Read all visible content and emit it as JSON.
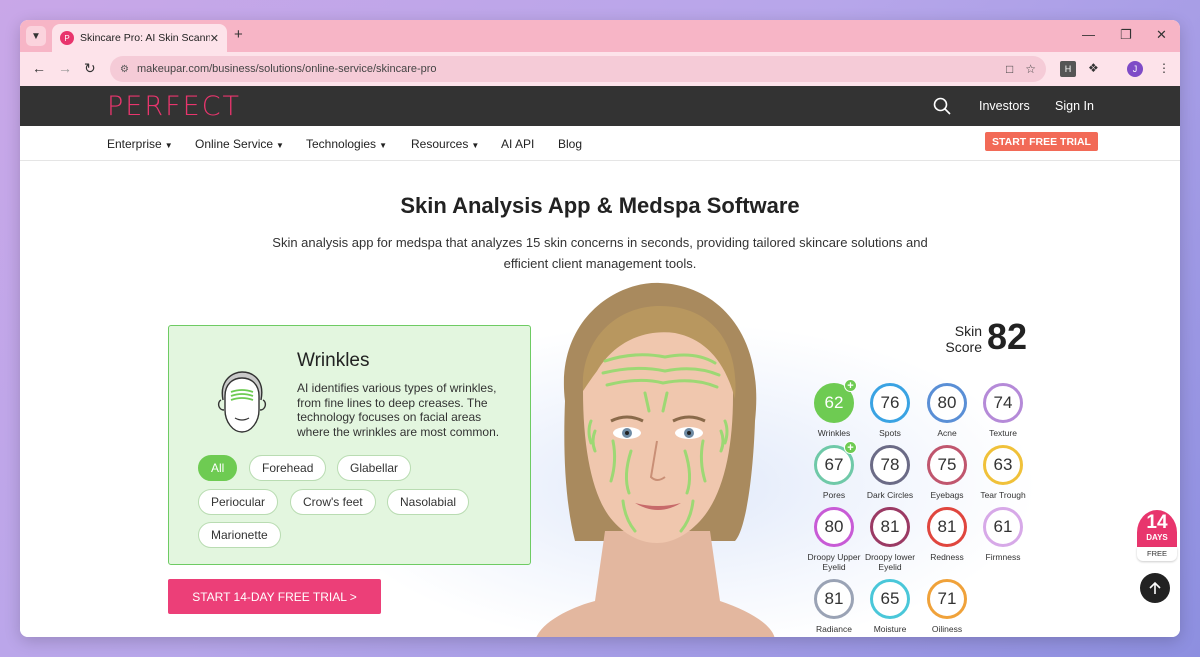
{
  "browser": {
    "tab_title": "Skincare Pro: AI Skin Scanner",
    "tab_favicon_letter": "P",
    "url": "makeupar.com/business/solutions/online-service/skincare-pro",
    "ext_letter": "H",
    "profile_letter": "J"
  },
  "site": {
    "logo": "PERFECT",
    "top_links": [
      "Investors",
      "Sign In"
    ],
    "nav": [
      "Enterprise",
      "Online Service",
      "Technologies",
      "Resources",
      "AI API",
      "Blog"
    ],
    "trial_button": "START FREE TRIAL"
  },
  "hero": {
    "title": "Skin Analysis App & Medspa Software",
    "subtitle": "Skin analysis app for medspa that analyzes 15 skin concerns in seconds, providing tailored skincare solutions and efficient client management tools.",
    "cta": "START 14-DAY FREE TRIAL >"
  },
  "feature_card": {
    "title": "Wrinkles",
    "description": "AI identifies various types of wrinkles, from fine lines to deep creases. The technology focuses on facial areas where the wrinkles are most common.",
    "chips": [
      "All",
      "Forehead",
      "Glabellar",
      "Periocular",
      "Crow's feet",
      "Nasolabial",
      "Marionette"
    ],
    "active_chip": "All"
  },
  "skin_score": {
    "label_line1": "Skin",
    "label_line2": "Score",
    "value": "82"
  },
  "metrics": [
    {
      "value": "62",
      "label": "Wrinkles",
      "color": "#6ecb52"
    },
    {
      "value": "76",
      "label": "Spots",
      "color": "#3aa3e3"
    },
    {
      "value": "80",
      "label": "Acne",
      "color": "#5a8fd6"
    },
    {
      "value": "74",
      "label": "Texture",
      "color": "#b58ad8"
    },
    {
      "value": "67",
      "label": "Pores",
      "color": "#6fc9a8"
    },
    {
      "value": "78",
      "label": "Dark Circles",
      "color": "#6b6b86"
    },
    {
      "value": "75",
      "label": "Eyebags",
      "color": "#c0566e"
    },
    {
      "value": "63",
      "label": "Tear Trough",
      "color": "#f0c13a"
    },
    {
      "value": "80",
      "label": "Droopy Upper Eyelid",
      "color": "#c85bd6"
    },
    {
      "value": "81",
      "label": "Droopy lower Eyelid",
      "color": "#9b3a64"
    },
    {
      "value": "81",
      "label": "Redness",
      "color": "#e0463e"
    },
    {
      "value": "61",
      "label": "Firmness",
      "color": "#d7a9e8"
    },
    {
      "value": "81",
      "label": "Radiance",
      "color": "#9aa3b5"
    },
    {
      "value": "65",
      "label": "Moisture",
      "color": "#4ac7d9"
    },
    {
      "value": "71",
      "label": "Oiliness",
      "color": "#f0a23a"
    }
  ],
  "badge": {
    "days_number": "14",
    "days_label": "DAYS",
    "free_label": "FREE"
  }
}
